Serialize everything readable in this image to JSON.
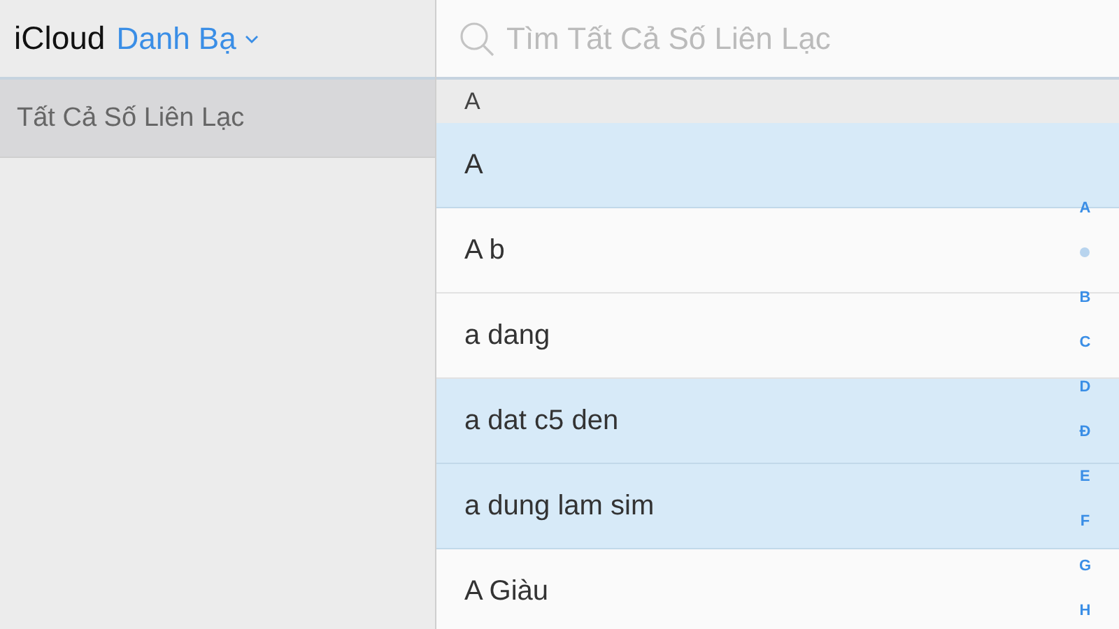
{
  "header": {
    "brand": "iCloud",
    "app_menu": "Danh Bạ"
  },
  "sidebar": {
    "items": [
      {
        "label": "Tất Cả Số Liên Lạc",
        "selected": true
      }
    ]
  },
  "search": {
    "placeholder": "Tìm Tất Cả Số Liên Lạc"
  },
  "contacts": {
    "section": "A",
    "rows": [
      {
        "name": "A",
        "selected": true
      },
      {
        "name": "A b",
        "selected": false
      },
      {
        "name": "a dang",
        "selected": false
      },
      {
        "name": "a dat c5 den",
        "selected": true
      },
      {
        "name": "a dung lam sim",
        "selected": true
      },
      {
        "name": "A Giàu",
        "selected": false
      }
    ]
  },
  "index": [
    {
      "kind": "letter",
      "label": "A"
    },
    {
      "kind": "dot"
    },
    {
      "kind": "letter",
      "label": "B"
    },
    {
      "kind": "letter",
      "label": "C"
    },
    {
      "kind": "letter",
      "label": "D"
    },
    {
      "kind": "letter",
      "label": "Đ"
    },
    {
      "kind": "letter",
      "label": "E"
    },
    {
      "kind": "letter",
      "label": "F"
    },
    {
      "kind": "letter",
      "label": "G"
    },
    {
      "kind": "letter",
      "label": "H"
    }
  ]
}
